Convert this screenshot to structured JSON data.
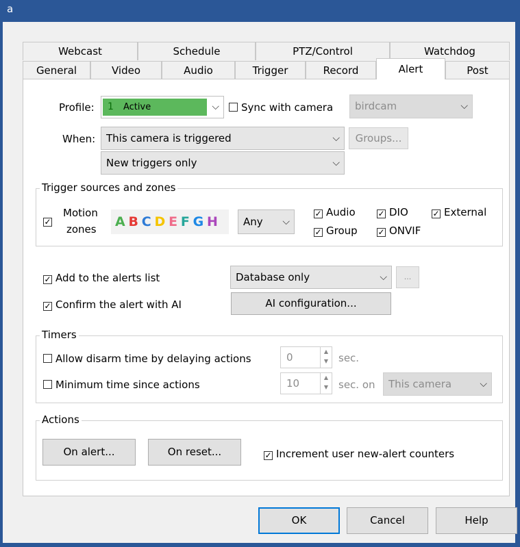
{
  "window": {
    "title": "a"
  },
  "tabs_row1": [
    "Webcast",
    "Schedule",
    "PTZ/Control",
    "Watchdog"
  ],
  "tabs_row2": [
    "General",
    "Video",
    "Audio",
    "Trigger",
    "Record",
    "Alert",
    "Post"
  ],
  "active_tab": "Alert",
  "profile": {
    "label": "Profile:",
    "value": "Active",
    "badge": "1",
    "sync_label": "Sync with camera",
    "sync_checked": false,
    "camera_value": "birdcam",
    "profile_color": "#5cb85c"
  },
  "when": {
    "label": "When:",
    "value": "This camera is triggered",
    "groups_button": "Groups...",
    "triggers_value": "New triggers only"
  },
  "trigger_sources": {
    "title": "Trigger sources and zones",
    "motion_label_1": "Motion",
    "motion_label_2": "zones",
    "motion_checked": true,
    "zones": [
      {
        "letter": "A",
        "color": "#4caf50"
      },
      {
        "letter": "B",
        "color": "#e53935"
      },
      {
        "letter": "C",
        "color": "#2e7bd6"
      },
      {
        "letter": "D",
        "color": "#f5c400"
      },
      {
        "letter": "E",
        "color": "#ef6c8a"
      },
      {
        "letter": "F",
        "color": "#26a69a"
      },
      {
        "letter": "G",
        "color": "#1e88e5"
      },
      {
        "letter": "H",
        "color": "#ab47bc"
      }
    ],
    "zone_mode": "Any",
    "audio": "Audio",
    "dio": "DIO",
    "external": "External",
    "group": "Group",
    "onvif": "ONVIF"
  },
  "alerts_list": {
    "label": "Add to the alerts list",
    "value": "Database only",
    "more": "..."
  },
  "ai": {
    "label": "Confirm the alert with AI",
    "button": "AI configuration..."
  },
  "timers": {
    "title": "Timers",
    "disarm_label": "Allow disarm time by delaying actions",
    "disarm_value": "0",
    "disarm_unit": "sec.",
    "min_label": "Minimum time since actions",
    "min_value": "10",
    "min_unit": "sec. on",
    "min_target": "This camera"
  },
  "actions": {
    "title": "Actions",
    "on_alert": "On alert...",
    "on_reset": "On reset...",
    "increment_label": "Increment user new-alert counters"
  },
  "footer": {
    "ok": "OK",
    "cancel": "Cancel",
    "help": "Help"
  }
}
